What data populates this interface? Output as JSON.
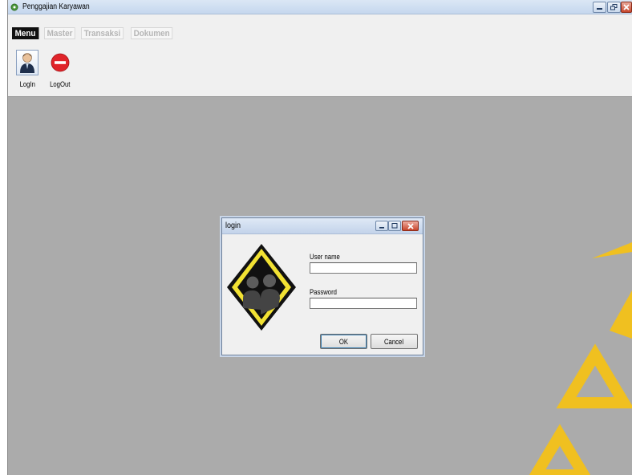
{
  "window": {
    "title": "Penggajian Karyawan"
  },
  "menu": {
    "tabs": [
      "Menu",
      "Master",
      "Transaksi",
      "Dokumen"
    ]
  },
  "toolbar": {
    "login_label": "LogIn",
    "logout_label": "LogOut"
  },
  "dialog": {
    "title": "login",
    "username_label": "User name",
    "username_value": "",
    "password_label": "Password",
    "password_value": "",
    "ok_label": "OK",
    "cancel_label": "Cancel"
  },
  "colors": {
    "client_area": "#ababab",
    "watermark": "#f0c020",
    "logout_icon": "#e0242a",
    "logo_fill": "#f2e233"
  },
  "icons": [
    "app-icon",
    "minimize-icon",
    "restore-icon",
    "close-icon",
    "user-icon",
    "logout-icon",
    "users-warning-icon"
  ]
}
